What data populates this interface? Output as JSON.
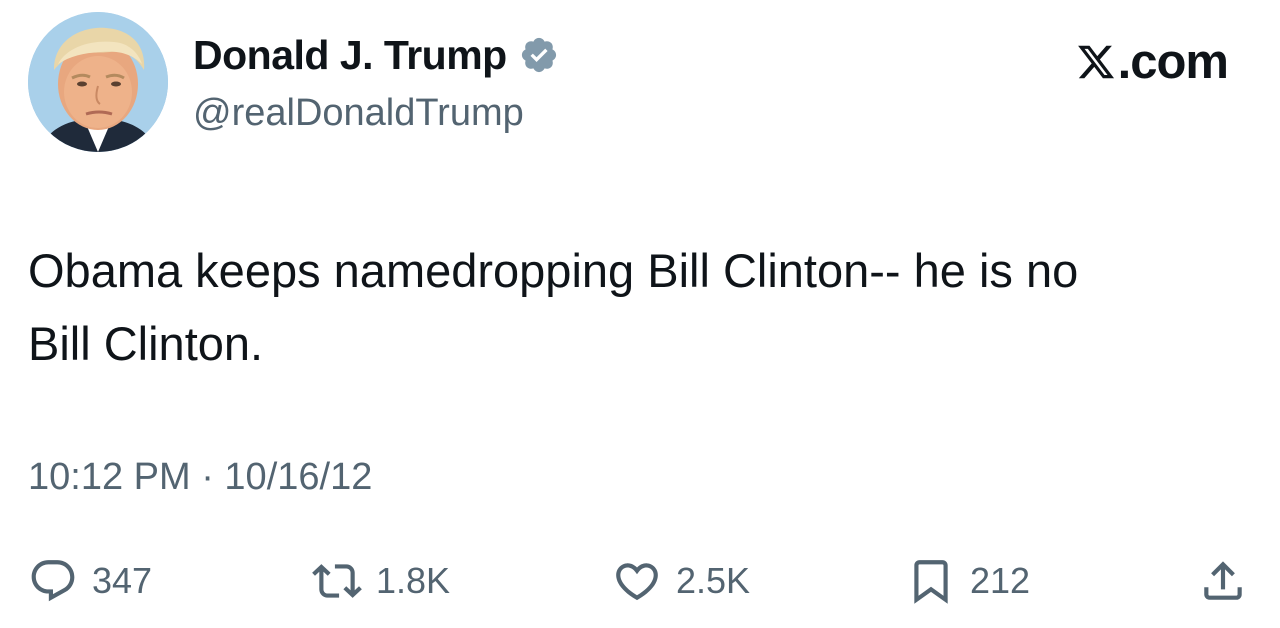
{
  "author": {
    "display_name": "Donald J. Trump",
    "handle": "@realDonaldTrump",
    "verified": true,
    "verified_color": "#829aab"
  },
  "brand": {
    "label": ".com",
    "logo_icon": "x-logo-icon"
  },
  "tweet": {
    "text": "Obama keeps namedropping Bill Clinton-- he is no\nBill Clinton.",
    "timestamp": "10:12 PM · 10/16/12"
  },
  "actions": {
    "reply": {
      "icon": "reply-icon",
      "count": "347"
    },
    "retweet": {
      "icon": "retweet-icon",
      "count": "1.8K"
    },
    "like": {
      "icon": "heart-icon",
      "count": "2.5K"
    },
    "bookmark": {
      "icon": "bookmark-icon",
      "count": "212"
    },
    "share": {
      "icon": "share-icon"
    }
  },
  "colors": {
    "text_primary": "#0f1419",
    "text_secondary": "#536471"
  }
}
